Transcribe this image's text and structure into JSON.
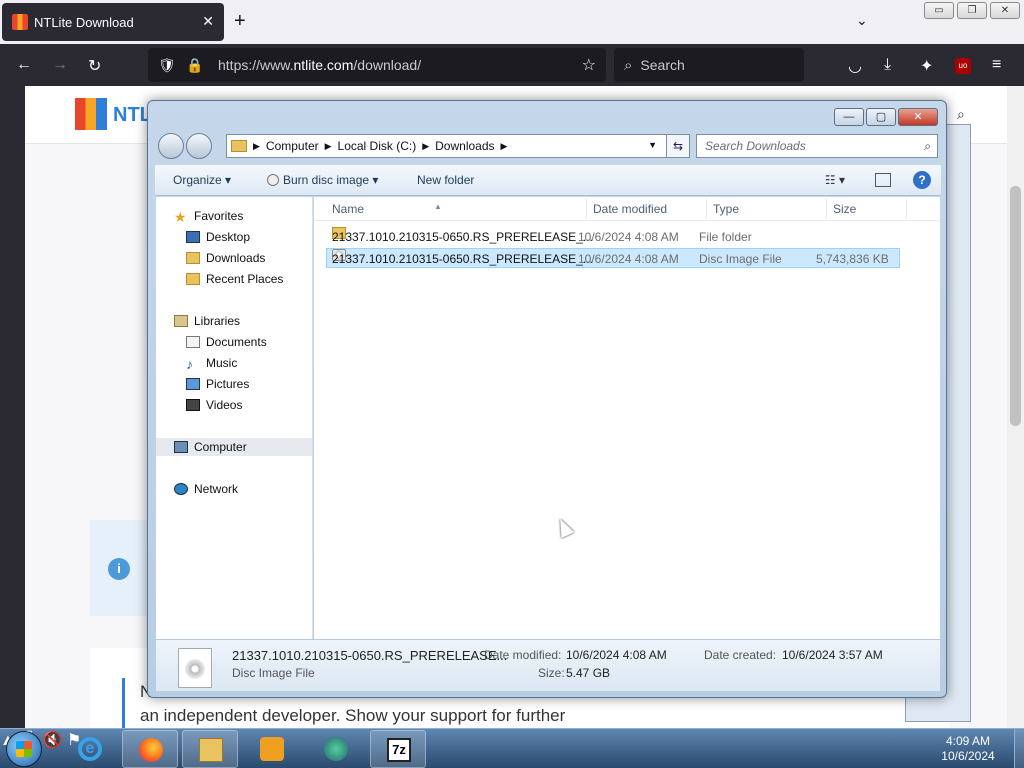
{
  "browser": {
    "tab_title": "NTLite Download",
    "tab_close": "✕",
    "new_tab": "+",
    "list_tabs": "⌄",
    "url_prefix": "https://www.",
    "url_host": "ntlite.com",
    "url_path": "/download/",
    "search_placeholder": "Search",
    "window_controls": [
      "▭",
      "❐",
      "✕"
    ],
    "nav_icons": {
      "back": "←",
      "forward": "→",
      "reload": "↻",
      "shield": "🛡",
      "lock": "🔒",
      "star": "☆",
      "pocket": "◡",
      "download": "⤓",
      "extensions": "✦",
      "ublock": "uo",
      "menu": "≡"
    }
  },
  "webpage": {
    "logo_text": "NTL",
    "partial_text": "N",
    "partial_text2": "an independent developer. Show your support for further",
    "info_icon": "i"
  },
  "explorer": {
    "window_controls": [
      "—",
      "▢",
      "✕"
    ],
    "breadcrumbs": [
      "Computer",
      "Local Disk (C:)",
      "Downloads"
    ],
    "search_placeholder": "Search Downloads",
    "toolbar": {
      "organize": "Organize",
      "burn": "Burn disc image",
      "new_folder": "New folder",
      "dropdown": "▾",
      "help": "?"
    },
    "nav": {
      "favorites": "Favorites",
      "desktop": "Desktop",
      "downloads": "Downloads",
      "recent": "Recent Places",
      "libraries": "Libraries",
      "documents": "Documents",
      "music": "Music",
      "pictures": "Pictures",
      "videos": "Videos",
      "computer": "Computer",
      "network": "Network"
    },
    "columns": {
      "name": "Name",
      "date": "Date modified",
      "type": "Type",
      "size": "Size"
    },
    "rows": [
      {
        "name": "21337.1010.210315-0650.RS_PRERELEASE_...",
        "date": "10/6/2024 4:08 AM",
        "type": "File folder",
        "size": ""
      },
      {
        "name": "21337.1010.210315-0650.RS_PRERELEASE_...",
        "date": "10/6/2024 4:08 AM",
        "type": "Disc Image File",
        "size": "5,743,836 KB"
      }
    ],
    "details": {
      "name": "21337.1010.210315-0650.RS_PRERELEASE...",
      "type": "Disc Image File",
      "modified_label": "Date modified:",
      "modified_value": "10/6/2024 4:08 AM",
      "created_label": "Date created:",
      "created_value": "10/6/2024 3:57 AM",
      "size_label": "Size:",
      "size_value": "5.47 GB"
    }
  },
  "taskbar": {
    "sevenzip_label": "7z",
    "ie_label": "e",
    "time": "4:09 AM",
    "date": "10/6/2024",
    "tray_icons": {
      "up": "▲",
      "network": "🖧",
      "volume": "🔇",
      "flag": "⚑"
    }
  }
}
